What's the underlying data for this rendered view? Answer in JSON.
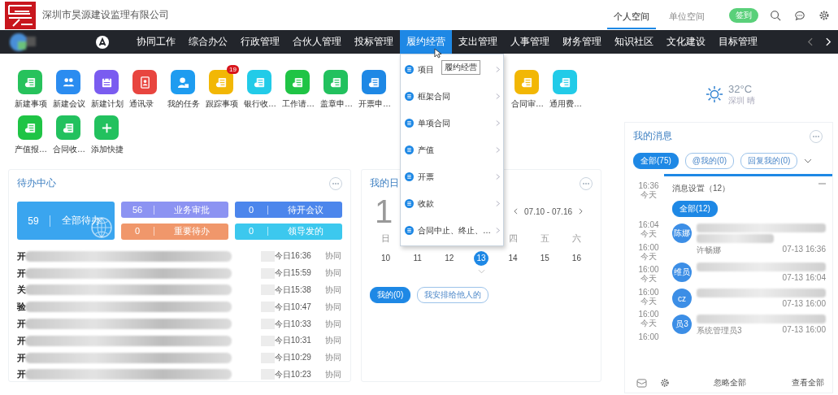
{
  "header": {
    "company": "深圳市昊源建设监理有限公司",
    "spaces": [
      {
        "label": "个人空间",
        "selected": true
      },
      {
        "label": "单位空间",
        "selected": false
      }
    ],
    "checkin": "签到"
  },
  "nav": {
    "items": [
      {
        "label": "协同工作",
        "selected": false
      },
      {
        "label": "综合办公",
        "selected": false
      },
      {
        "label": "行政管理",
        "selected": false
      },
      {
        "label": "合伙人管理",
        "selected": false
      },
      {
        "label": "投标管理",
        "selected": false
      },
      {
        "label": "履约经营",
        "selected": true
      },
      {
        "label": "支出管理",
        "selected": false
      },
      {
        "label": "人事管理",
        "selected": false
      },
      {
        "label": "财务管理",
        "selected": false
      },
      {
        "label": "知识社区",
        "selected": false
      },
      {
        "label": "文化建设",
        "selected": false
      },
      {
        "label": "目标管理",
        "selected": false
      }
    ]
  },
  "dropdown": {
    "items": [
      "项目",
      "框架合同",
      "单项合同",
      "产值",
      "开票",
      "收款",
      "合同中止、终止、…"
    ],
    "tooltip": "履约经营"
  },
  "shortcut_rows": [
    {
      "left": [
        {
          "label": "新建事项",
          "kind": "doc",
          "color": "#27c25c"
        },
        {
          "label": "新建会议",
          "kind": "people",
          "color": "#2b8cf0"
        },
        {
          "label": "新建计划",
          "kind": "calendar",
          "color": "#7a5cf0"
        },
        {
          "label": "通讯录",
          "kind": "contacts",
          "color": "#e8453f"
        },
        {
          "label": "我的任务",
          "kind": "person",
          "color": "#1e9cf0"
        },
        {
          "label": "跟踪事项",
          "kind": "doc",
          "color": "#f2b705",
          "badge": "19"
        },
        {
          "label": "银行收…",
          "kind": "doc",
          "color": "#22cbe8"
        },
        {
          "label": "工作请…",
          "kind": "doc",
          "color": "#1fc445"
        },
        {
          "label": "盖章申…",
          "kind": "doc",
          "color": "#22c15e"
        },
        {
          "label": "开票申…",
          "kind": "doc",
          "color": "#1e88e5"
        }
      ],
      "right": [
        {
          "label": "合同审…",
          "kind": "doc",
          "color": "#f2b705"
        },
        {
          "label": "通用费…",
          "kind": "doc",
          "color": "#22cbe8"
        }
      ]
    },
    {
      "left": [
        {
          "label": "产值报…",
          "kind": "doc",
          "color": "#1fc445"
        },
        {
          "label": "合同收…",
          "kind": "doc",
          "color": "#22c15e"
        },
        {
          "label": "添加快捷",
          "kind": "plus",
          "color": "#22c15e"
        }
      ],
      "right": []
    }
  ],
  "weather": {
    "temperature": "32°C",
    "place": "深圳 晴"
  },
  "todo": {
    "title": "待办中心",
    "main": {
      "count": "59",
      "label": "全部待办"
    },
    "tiles": [
      {
        "count": "56",
        "label": "业务审批",
        "color": "#8c93f2"
      },
      {
        "count": "0",
        "label": "待开会议",
        "color": "#4c86ec"
      },
      {
        "count": "0",
        "label": "重要待办",
        "color": "#f0976b"
      },
      {
        "count": "0",
        "label": "领导发的",
        "color": "#3cc8ee"
      }
    ],
    "rows": [
      {
        "title": "开",
        "time": "今日16:36",
        "source": "协同"
      },
      {
        "title": "开",
        "time": "今日15:59",
        "source": "协同"
      },
      {
        "title": "关",
        "time": "今日15:38",
        "source": "协同"
      },
      {
        "title": "验",
        "time": "今日10:47",
        "source": "协同"
      },
      {
        "title": "开",
        "time": "今日10:33",
        "source": "协同"
      },
      {
        "title": "开",
        "time": "今日10:31",
        "source": "协同"
      },
      {
        "title": "开",
        "time": "今日10:29",
        "source": "协同"
      },
      {
        "title": "开",
        "time": "今日10:23",
        "source": "协同"
      }
    ]
  },
  "calendar": {
    "title": "我的日",
    "big_date": "1",
    "range": "07.10 - 07.16",
    "weekdays": {
      "left": [
        "日"
      ],
      "right": [
        "四",
        "五",
        "六"
      ]
    },
    "days": [
      {
        "label": "10",
        "selected": false
      },
      {
        "label": "11",
        "selected": false
      },
      {
        "label": "12",
        "selected": false
      },
      {
        "label": "13",
        "selected": true
      },
      {
        "label": "14",
        "selected": false
      },
      {
        "label": "15",
        "selected": false
      },
      {
        "label": "16",
        "selected": false
      }
    ],
    "filters": [
      {
        "label": "我的(0)",
        "selected": true
      },
      {
        "label": "我安排给他人的",
        "selected": false
      }
    ]
  },
  "messages": {
    "title": "我的消息",
    "filters": [
      {
        "label": "全部(75)",
        "selected": true
      },
      {
        "label": "@我的(0)",
        "selected": false
      },
      {
        "label": "回复我的(0)",
        "selected": false
      }
    ],
    "timeline": [
      {
        "time": "16:36",
        "day": "今天"
      },
      {
        "time": "16:04",
        "day": "今天"
      },
      {
        "time": "16:00",
        "day": "今天"
      },
      {
        "time": "16:00",
        "day": "今天"
      },
      {
        "time": "16:00",
        "day": "今天"
      },
      {
        "time": "16:00",
        "day": "今天"
      },
      {
        "time": "16:00"
      }
    ],
    "settings": "消息设置（12）",
    "all": "全部(12)",
    "items": [
      {
        "avatar": "陈娜",
        "sender": "许畅娜",
        "date": "07-13 16:36",
        "extra_line": true
      },
      {
        "avatar": "维员",
        "date": "07-13 16:04",
        "extra_line": false
      },
      {
        "avatar": "cz",
        "date": "07-13 16:00",
        "extra_line": false
      },
      {
        "avatar": "员3",
        "sender": "系统管理员3",
        "date": "07-13 16:00",
        "extra_line": false
      }
    ],
    "ignore_all": "忽略全部",
    "view_all": "查看全部"
  }
}
